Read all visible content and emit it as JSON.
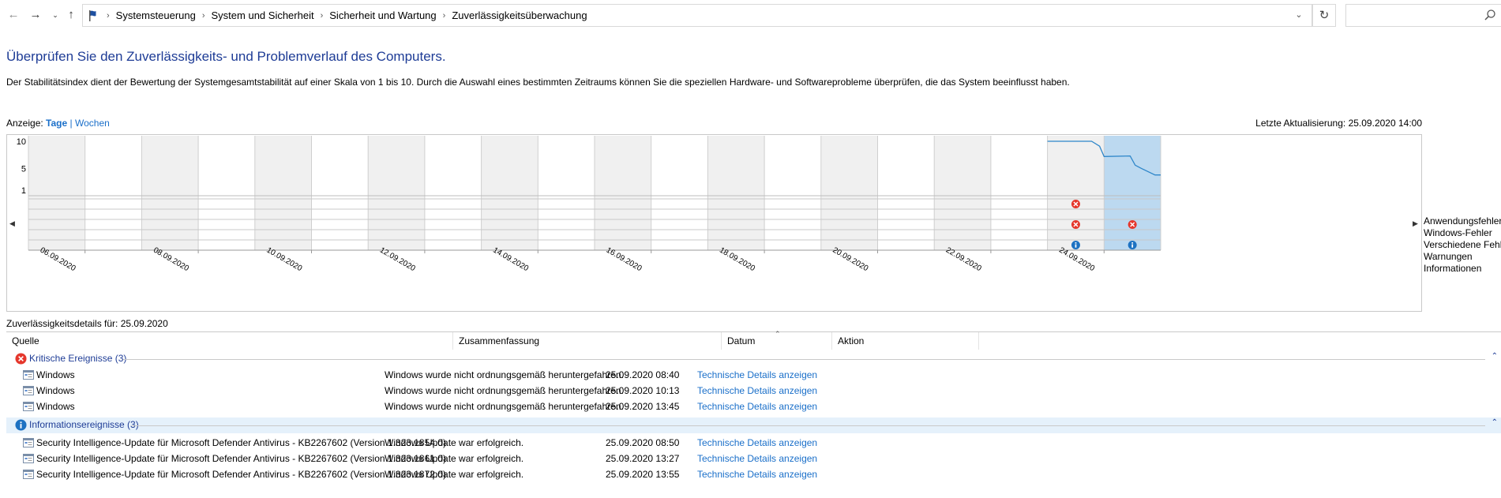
{
  "breadcrumb": {
    "items": [
      "Systemsteuerung",
      "System und Sicherheit",
      "Sicherheit und Wartung",
      "Zuverlässigkeitsüberwachung"
    ]
  },
  "page": {
    "title": "Überprüfen Sie den Zuverlässigkeits- und Problemverlauf des Computers.",
    "description": "Der Stabilitätsindex dient der Bewertung der Systemgesamtstabilität auf einer Skala von 1 bis 10. Durch die Auswahl eines bestimmten Zeitraums können Sie die speziellen Hardware- und Softwareprobleme überprüfen, die das System beeinflusst haben.",
    "view_label": "Anzeige:",
    "view_days": "Tage",
    "view_separator": "|",
    "view_weeks": "Wochen",
    "last_update": "Letzte Aktualisierung: 25.09.2020 14:00"
  },
  "chart_data": {
    "type": "line",
    "y_ticks": [
      "10",
      "5",
      "1"
    ],
    "ylim": [
      1,
      10
    ],
    "x_labels": [
      "06.09.2020",
      "08.09.2020",
      "10.09.2020",
      "12.09.2020",
      "14.09.2020",
      "16.09.2020",
      "18.09.2020",
      "20.09.2020",
      "22.09.2020",
      "24.09.2020"
    ],
    "stability_index": [
      {
        "t": 18.0,
        "y": 10.0
      },
      {
        "t": 18.78,
        "y": 10.0
      },
      {
        "t": 18.92,
        "y": 9.1
      },
      {
        "t": 19.0,
        "y": 7.2
      },
      {
        "t": 19.46,
        "y": 7.3
      },
      {
        "t": 19.55,
        "y": 5.6
      },
      {
        "t": 19.66,
        "y": 5.0
      },
      {
        "t": 19.78,
        "y": 4.4
      },
      {
        "t": 19.9,
        "y": 3.8
      },
      {
        "t": 20.0,
        "y": 3.8
      }
    ],
    "selected_day": "25.09.2020",
    "event_rows": [
      "Anwendungsfehler",
      "Windows-Fehler",
      "Verschiedene Fehler",
      "Warnungen",
      "Informationen"
    ],
    "events": [
      {
        "day": "24.09.2020",
        "row": "Anwendungsfehler",
        "kind": "error"
      },
      {
        "day": "24.09.2020",
        "row": "Verschiedene Fehler",
        "kind": "error"
      },
      {
        "day": "24.09.2020",
        "row": "Informationen",
        "kind": "info"
      },
      {
        "day": "25.09.2020",
        "row": "Verschiedene Fehler",
        "kind": "error"
      },
      {
        "day": "25.09.2020",
        "row": "Informationen",
        "kind": "info"
      }
    ],
    "colors": {
      "line": "#2e86c9",
      "selected": "#bcd9f0",
      "error": "#e5372c",
      "info": "#1d72c2",
      "shade": "#f0f0f0"
    }
  },
  "details": {
    "label": "Zuverlässigkeitsdetails für: 25.09.2020",
    "columns": [
      "Quelle",
      "Zusammenfassung",
      "Datum",
      "Aktion"
    ],
    "groups": [
      {
        "title": "Kritische Ereignisse (3)",
        "icon": "error-icon",
        "rows": [
          {
            "source": "Windows",
            "summary": "Windows wurde nicht ordnungsgemäß heruntergefahren.",
            "date": "25.09.2020 08:40",
            "action": "Technische Details anzeigen"
          },
          {
            "source": "Windows",
            "summary": "Windows wurde nicht ordnungsgemäß heruntergefahren.",
            "date": "25.09.2020 10:13",
            "action": "Technische Details anzeigen"
          },
          {
            "source": "Windows",
            "summary": "Windows wurde nicht ordnungsgemäß heruntergefahren.",
            "date": "25.09.2020 13:45",
            "action": "Technische Details anzeigen"
          }
        ]
      },
      {
        "title": "Informationsereignisse (3)",
        "icon": "info-icon",
        "rows": [
          {
            "source": "Security Intelligence-Update für Microsoft Defender Antivirus - KB2267602 (Version 1.323.1854.0)",
            "summary": "Windows Update war erfolgreich.",
            "date": "25.09.2020 08:50",
            "action": "Technische Details anzeigen"
          },
          {
            "source": "Security Intelligence-Update für Microsoft Defender Antivirus - KB2267602 (Version 1.323.1861.0)",
            "summary": "Windows Update war erfolgreich.",
            "date": "25.09.2020 13:27",
            "action": "Technische Details anzeigen"
          },
          {
            "source": "Security Intelligence-Update für Microsoft Defender Antivirus - KB2267602 (Version 1.323.1872.0)",
            "summary": "Windows Update war erfolgreich.",
            "date": "25.09.2020 13:55",
            "action": "Technische Details anzeigen"
          }
        ]
      }
    ]
  }
}
